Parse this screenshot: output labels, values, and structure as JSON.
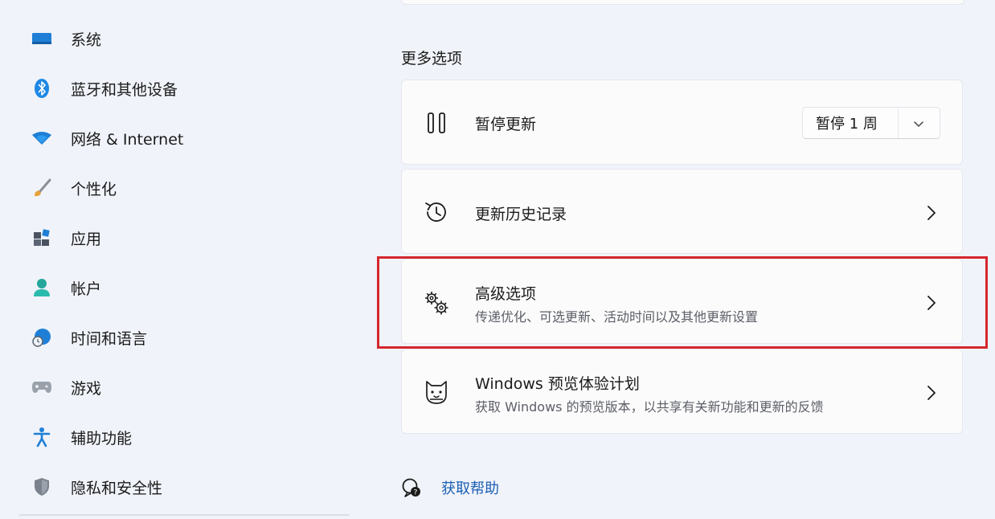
{
  "sidebar": {
    "items": [
      {
        "label": "系统",
        "icon": "monitor-icon"
      },
      {
        "label": "蓝牙和其他设备",
        "icon": "bluetooth-icon"
      },
      {
        "label": "网络 & Internet",
        "icon": "wifi-icon"
      },
      {
        "label": "个性化",
        "icon": "paintbrush-icon"
      },
      {
        "label": "应用",
        "icon": "apps-icon"
      },
      {
        "label": "帐户",
        "icon": "person-icon"
      },
      {
        "label": "时间和语言",
        "icon": "globe-clock-icon"
      },
      {
        "label": "游戏",
        "icon": "gamepad-icon"
      },
      {
        "label": "辅助功能",
        "icon": "accessibility-icon"
      },
      {
        "label": "隐私和安全性",
        "icon": "shield-icon"
      }
    ]
  },
  "main": {
    "section_title": "更多选项",
    "pause": {
      "title": "暂停更新",
      "select_value": "暂停 1 周"
    },
    "history": {
      "title": "更新历史记录"
    },
    "advanced": {
      "title": "高级选项",
      "subtitle": "传递优化、可选更新、活动时间以及其他更新设置"
    },
    "insider": {
      "title": "Windows 预览体验计划",
      "subtitle": "获取 Windows 的预览版本，以共享有关新功能和更新的反馈"
    },
    "help_link": "获取帮助"
  },
  "colors": {
    "background": "#f0f3f9",
    "card": "#fbfbfc",
    "link": "#1a5fb4",
    "highlight": "#d6262e",
    "accent_blue": "#0067c0"
  }
}
